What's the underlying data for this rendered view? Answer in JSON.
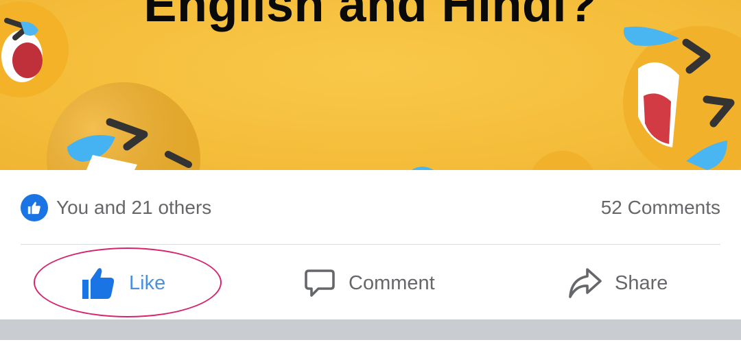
{
  "post": {
    "image_title": "English and Hindi?",
    "image_alt_icon": "laughing-emoji"
  },
  "reactions": {
    "icon": "thumbs-up-icon",
    "summary": "You and 21 others",
    "comments_count": "52 Comments"
  },
  "actions": {
    "like_label": "Like",
    "comment_label": "Comment",
    "share_label": "Share"
  },
  "colors": {
    "like_active": "#4a90e2",
    "badge_blue": "#1b74e4",
    "muted_text": "#65676b",
    "highlight_ring": "#d6246e"
  }
}
